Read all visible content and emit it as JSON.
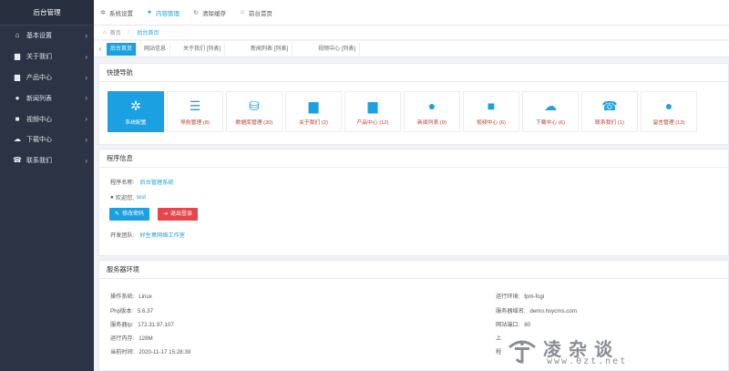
{
  "sidebar": {
    "brand": "后台管理",
    "items": [
      {
        "label": "基本设置",
        "icon": "home-icon"
      },
      {
        "label": "关于我们",
        "icon": "briefcase-icon"
      },
      {
        "label": "产品中心",
        "icon": "briefcase-icon"
      },
      {
        "label": "新闻列表",
        "icon": "comment-icon"
      },
      {
        "label": "视频中心",
        "icon": "video-icon"
      },
      {
        "label": "下载中心",
        "icon": "cloud-download-icon"
      },
      {
        "label": "联系我们",
        "icon": "phone-icon"
      }
    ]
  },
  "topbar": {
    "items": [
      {
        "label": "系统设置",
        "icon": "gear-icon"
      },
      {
        "label": "内容管理",
        "icon": "comment-icon"
      },
      {
        "label": "清除缓存",
        "icon": "refresh-icon"
      },
      {
        "label": "前台首页",
        "icon": "home-icon"
      }
    ]
  },
  "breadcrumb": {
    "home": "首页",
    "sep": "/",
    "current": "后台首页"
  },
  "tabs": [
    "后台首页",
    "网站信息",
    "关于我们 [列表]",
    "新闻列表 [列表]",
    "视频中心 [列表]"
  ],
  "quick_nav": {
    "title": "快捷导航",
    "items": [
      {
        "label": "系统配置",
        "icon": "gear-icon"
      },
      {
        "label": "导航管理 (8)",
        "icon": "list-icon"
      },
      {
        "label": "数据库管理 (20)",
        "icon": "database-icon"
      },
      {
        "label": "关于我们 (2)",
        "icon": "briefcase-icon"
      },
      {
        "label": "产品中心 (12)",
        "icon": "briefcase-icon"
      },
      {
        "label": "新闻列表 (9)",
        "icon": "comment-icon"
      },
      {
        "label": "视频中心 (6)",
        "icon": "video-icon"
      },
      {
        "label": "下载中心 (6)",
        "icon": "cloud-download-icon"
      },
      {
        "label": "联系我们 (1)",
        "icon": "phone-icon"
      },
      {
        "label": "留言管理 (13)",
        "icon": "comments-icon"
      }
    ]
  },
  "program": {
    "title": "程序信息",
    "name_label": "程序名称:",
    "name_value": "后台管理系统",
    "welcome_label": "欢迎您,",
    "welcome_value": "test",
    "change_pwd": "修改密码",
    "logout": "退出登录",
    "team_label": "开发团队:",
    "team_value": "好生意网络工作室"
  },
  "server": {
    "title": "服务器环境",
    "os_label": "操作系统:",
    "os_value": "Linux",
    "php_label": "Php版本:",
    "php_value": "5.6.37",
    "ip_label": "服务器Ip:",
    "ip_value": "172.31.97.107",
    "mem_label": "运行内存:",
    "mem_value": "128M",
    "time_label": "当前时间:",
    "time_value": "2020-11-17 15:28:39",
    "env_label": "运行环境:",
    "env_value": "fpm-fcgi",
    "domain_label": "服务器域名:",
    "domain_value": "demo.hsycms.com",
    "port_label": "网站端口:",
    "port_value": "80",
    "upload_label": "上",
    "extra_label": "程"
  },
  "watermark": {
    "text": "凌杂谈",
    "url": "www.0zt.net"
  },
  "colors": {
    "accent": "#1ba0e1",
    "danger": "#e8454a",
    "sidebar": "#2c3344"
  }
}
